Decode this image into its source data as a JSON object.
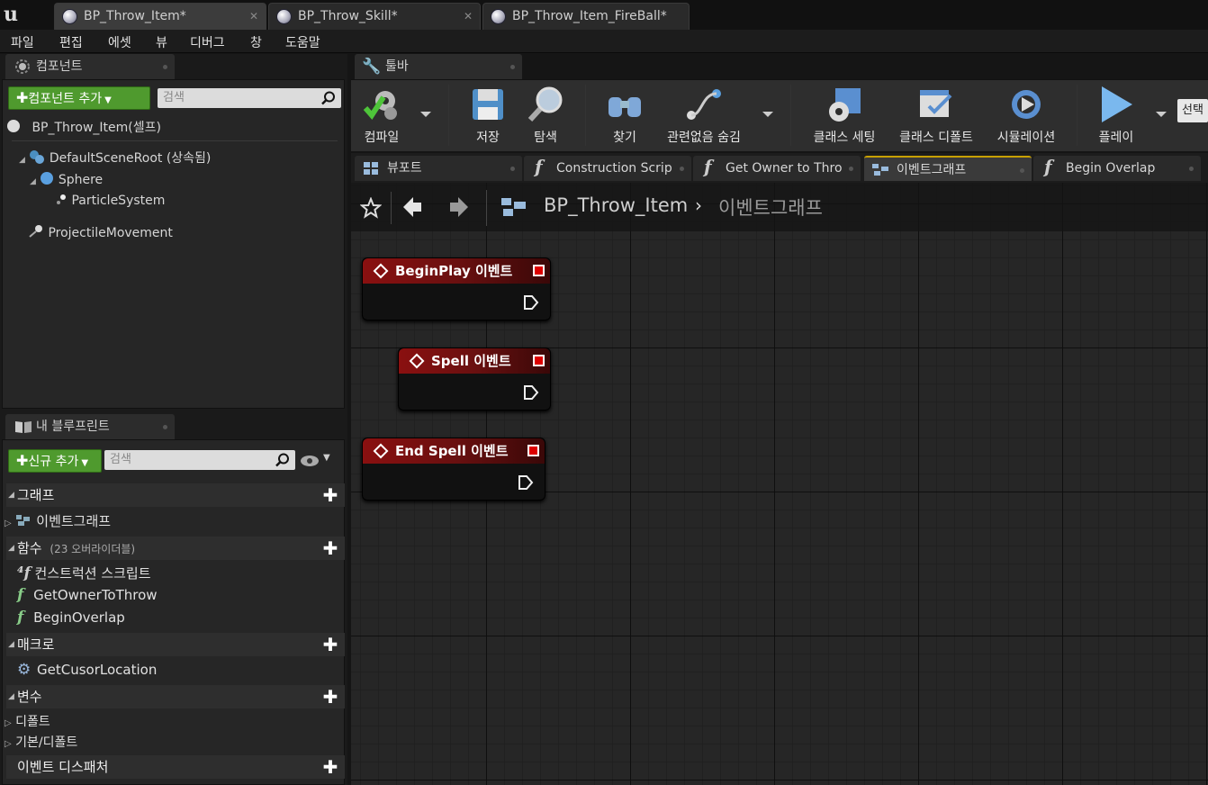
{
  "document_tabs": [
    {
      "label": "BP_Throw_Item*",
      "active": true
    },
    {
      "label": "BP_Throw_Skill*",
      "active": false
    },
    {
      "label": "BP_Throw_Item_FireBall*",
      "active": false
    }
  ],
  "menu": [
    "파일",
    "편집",
    "에셋",
    "뷰",
    "디버그",
    "창",
    "도움말"
  ],
  "components_panel": {
    "title": "컴포넌트",
    "add_button": "컴포넌트 추가",
    "search_placeholder": "검색",
    "self_item": "BP_Throw_Item(셀프)",
    "tree": [
      {
        "label": "DefaultSceneRoot (상속됨)",
        "icon": "scene-root-icon"
      },
      {
        "label": "Sphere",
        "icon": "sphere-icon"
      },
      {
        "label": "ParticleSystem",
        "icon": "particle-icon"
      },
      {
        "label": "ProjectileMovement",
        "icon": "projectile-icon"
      }
    ]
  },
  "my_blueprint_panel": {
    "title": "내 블루프린트",
    "add_button": "신규 추가",
    "search_placeholder": "검색",
    "categories": {
      "graphs": "그래프",
      "functions": "함수",
      "functions_note": "(23 오버라이더블)",
      "macros": "매크로",
      "variables": "변수",
      "event_dispatchers": "이벤트 디스패처"
    },
    "graph_items": [
      "이벤트그래프"
    ],
    "function_items": [
      "컨스트럭션 스크립트",
      "GetOwnerToThrow",
      "BeginOverlap"
    ],
    "macro_items": [
      "GetCusorLocation"
    ],
    "variable_groups": [
      "디폴트",
      "기본/디폴트"
    ]
  },
  "toolbar": {
    "tab_label": "툴바",
    "buttons": {
      "compile": "컴파일",
      "save": "저장",
      "browse": "탐색",
      "find": "찾기",
      "hide_unrelated": "관련없음 숨김",
      "class_settings": "클래스 세팅",
      "class_defaults": "클래스 디폴트",
      "simulation": "시뮬레이션",
      "play": "플레이"
    },
    "debug_select": "선택"
  },
  "editor_tabs": [
    {
      "label": "뷰포트",
      "icon": "viewport-icon"
    },
    {
      "label": "Construction Scrip",
      "icon": "function-icon"
    },
    {
      "label": "Get Owner to Thro",
      "icon": "function-icon"
    },
    {
      "label": "이벤트그래프",
      "icon": "event-graph-icon",
      "active": true
    },
    {
      "label": "Begin Overlap",
      "icon": "function-icon"
    }
  ],
  "breadcrumb": {
    "blueprint": "BP_Throw_Item",
    "graph": "이벤트그래프"
  },
  "nodes": [
    {
      "title": "BeginPlay 이벤트"
    },
    {
      "title": "Spell 이벤트"
    },
    {
      "title": "End Spell 이벤트"
    }
  ],
  "colors": {
    "add_button_green": "#4f9a2e",
    "event_node_header": "#8a1010",
    "graph_background": "#262626",
    "active_tab_accent": "#c8a000"
  }
}
